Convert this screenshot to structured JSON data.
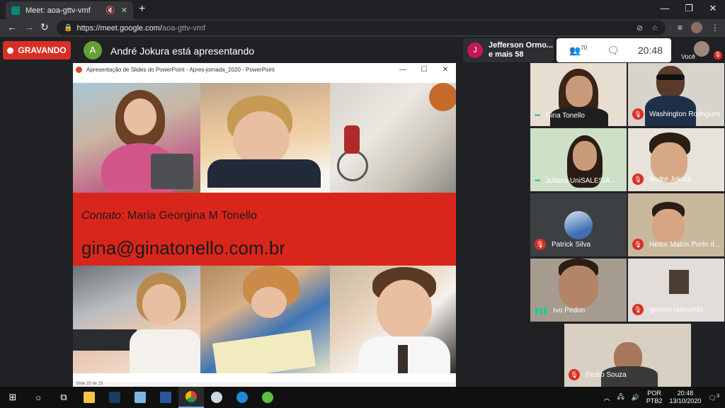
{
  "browser": {
    "tab_title": "Meet: aoa-gttv-vmf",
    "tab_mute": "🔇",
    "tab_close": "✕",
    "new_tab": "+",
    "win_min": "—",
    "win_max": "❐",
    "win_close": "✕",
    "url_host": "https://meet.google.com/",
    "url_path": "aoa-gttv-vmf"
  },
  "meet": {
    "recording_label": "GRAVANDO",
    "presenter_initial": "A",
    "presenter_text": "André Jokura está apresentando",
    "people_initial": "J",
    "people_line1": "Jefferson Ormo...",
    "people_line2": "e mais 58",
    "participant_count": "70",
    "clock": "20:48",
    "self_label": "Você"
  },
  "presentation": {
    "window_title": "Apresentação de Slides do PowerPoint  -  Apres-jornada_2020  -  PowerPoint",
    "contact_label": "Contato:",
    "contact_name": "Maria Georgina M Tonello",
    "email": "gina@ginatonello.com.br",
    "status_text": "Slide 23 de 23"
  },
  "participants": [
    {
      "name": "Gina Tonello",
      "audio": "speaking"
    },
    {
      "name": "Washington Rodrigues",
      "audio": "muted"
    },
    {
      "name": "Juliana UniSALESIA...",
      "audio": "speaking"
    },
    {
      "name": "André Jokura",
      "audio": "muted"
    },
    {
      "name": "Patrick Silva",
      "audio": "muted"
    },
    {
      "name": "Heitor Matos Porto d...",
      "audio": "muted"
    },
    {
      "name": "Ivo Pedon",
      "audio": "active"
    },
    {
      "name": "glaison raimundo",
      "audio": "muted"
    },
    {
      "name": "Pedro Souza",
      "audio": "muted"
    }
  ],
  "taskbar": {
    "lang_line1": "POR",
    "lang_line2": "PTB2",
    "time": "20:48",
    "date": "13/10/2020",
    "notif_count": "3"
  },
  "colors": {
    "record_red": "#d93025",
    "slide_red": "#d9261c",
    "meet_bg": "#202124"
  }
}
